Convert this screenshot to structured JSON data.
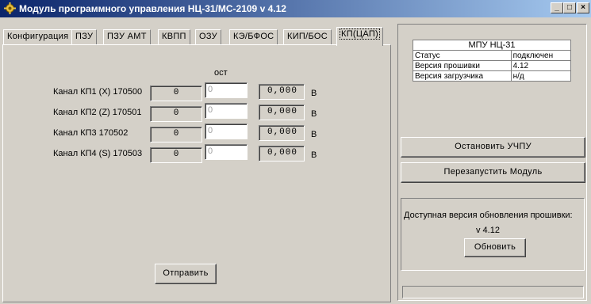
{
  "window": {
    "title": "Модуль программного управления НЦ-31/МС-2109 v 4.12",
    "icon": "gear-icon",
    "controls": {
      "minimize": "_",
      "maximize": "□",
      "close": "×"
    }
  },
  "tabs": [
    {
      "label": "Конфигурация"
    },
    {
      "label": "ПЗУ"
    },
    {
      "label": "ПЗУ АМТ"
    },
    {
      "label": "КВПП"
    },
    {
      "label": "ОЗУ"
    },
    {
      "label": "КЭ/БФОС"
    },
    {
      "label": "КИП/БОС"
    },
    {
      "label": "КП(ЦАП)"
    }
  ],
  "active_tab": "КП(ЦАП)",
  "panel": {
    "column_header": "ост",
    "channels": [
      {
        "label": "Канал КП1 (X) 170500",
        "value": "0",
        "input_placeholder": "0",
        "output": "0,000",
        "unit": "В"
      },
      {
        "label": "Канал КП2 (Z) 170501",
        "value": "0",
        "input_placeholder": "0",
        "output": "0,000",
        "unit": "В"
      },
      {
        "label": "Канал КП3  170502",
        "value": "0",
        "input_placeholder": "0",
        "output": "0,000",
        "unit": "В"
      },
      {
        "label": "Канал КП4 (S) 170503",
        "value": "0",
        "input_placeholder": "0",
        "output": "0,000",
        "unit": "В"
      }
    ],
    "send_button": "Отправить"
  },
  "info": {
    "title": "МПУ НЦ-31",
    "rows": [
      {
        "key": "Статус",
        "value": "подключен"
      },
      {
        "key": "Версия прошивки",
        "value": "4.12"
      },
      {
        "key": "Версия загрузчика",
        "value": "н/д"
      }
    ]
  },
  "actions": {
    "stop_label": "Остановить УЧПУ",
    "restart_label": "Перезапустить Модуль"
  },
  "update": {
    "text": "Доступная версия обновления прошивки:",
    "version": "v 4.12",
    "button": "Обновить"
  },
  "status_bar": {
    "text": ""
  }
}
